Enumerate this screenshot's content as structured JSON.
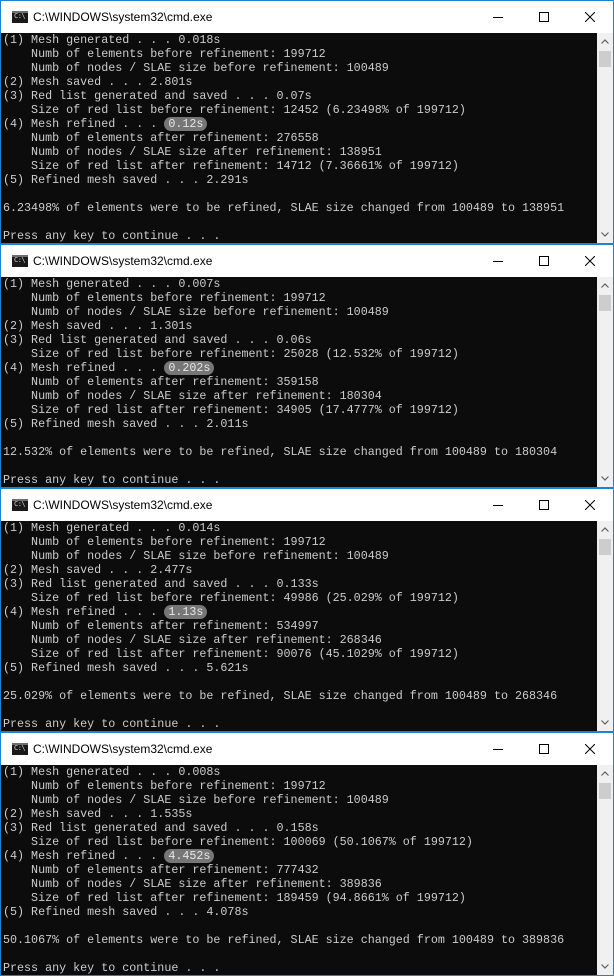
{
  "windows": [
    {
      "title": "C:\\WINDOWS\\system32\\cmd.exe",
      "lines": [
        {
          "text": "(1) Mesh generated . . . 0.018s"
        },
        {
          "text": "    Numb of elements before refinement: 199712"
        },
        {
          "text": "    Numb of nodes / SLAE size before refinement: 100489"
        },
        {
          "text": "(2) Mesh saved . . . 2.801s"
        },
        {
          "text": "(3) Red list generated and saved . . . 0.07s"
        },
        {
          "text": "    Size of red list before refinement: 12452 (6.23498% of 199712)"
        },
        {
          "text": "(4) Mesh refined . . . ",
          "highlight": "0.12s"
        },
        {
          "text": "    Numb of elements after refinement: 276558"
        },
        {
          "text": "    Numb of nodes / SLAE size after refinement: 138951"
        },
        {
          "text": "    Size of red list after refinement: 14712 (7.36661% of 199712)"
        },
        {
          "text": "(5) Refined mesh saved . . . 2.291s"
        },
        {
          "text": ""
        },
        {
          "text": "6.23498% of elements were to be refined, SLAE size changed from 100489 to 138951"
        },
        {
          "text": ""
        },
        {
          "text": "Press any key to continue . . ."
        }
      ]
    },
    {
      "title": "C:\\WINDOWS\\system32\\cmd.exe",
      "lines": [
        {
          "text": "(1) Mesh generated . . . 0.007s"
        },
        {
          "text": "    Numb of elements before refinement: 199712"
        },
        {
          "text": "    Numb of nodes / SLAE size before refinement: 100489"
        },
        {
          "text": "(2) Mesh saved . . . 1.301s"
        },
        {
          "text": "(3) Red list generated and saved . . . 0.06s"
        },
        {
          "text": "    Size of red list before refinement: 25028 (12.532% of 199712)"
        },
        {
          "text": "(4) Mesh refined . . . ",
          "highlight": "0.202s"
        },
        {
          "text": "    Numb of elements after refinement: 359158"
        },
        {
          "text": "    Numb of nodes / SLAE size after refinement: 180304"
        },
        {
          "text": "    Size of red list after refinement: 34905 (17.4777% of 199712)"
        },
        {
          "text": "(5) Refined mesh saved . . . 2.011s"
        },
        {
          "text": ""
        },
        {
          "text": "12.532% of elements were to be refined, SLAE size changed from 100489 to 180304"
        },
        {
          "text": ""
        },
        {
          "text": "Press any key to continue . . ."
        }
      ]
    },
    {
      "title": "C:\\WINDOWS\\system32\\cmd.exe",
      "lines": [
        {
          "text": "(1) Mesh generated . . . 0.014s"
        },
        {
          "text": "    Numb of elements before refinement: 199712"
        },
        {
          "text": "    Numb of nodes / SLAE size before refinement: 100489"
        },
        {
          "text": "(2) Mesh saved . . . 2.477s"
        },
        {
          "text": "(3) Red list generated and saved . . . 0.133s"
        },
        {
          "text": "    Size of red list before refinement: 49986 (25.029% of 199712)"
        },
        {
          "text": "(4) Mesh refined . . . ",
          "highlight": "1.13s"
        },
        {
          "text": "    Numb of elements after refinement: 534997"
        },
        {
          "text": "    Numb of nodes / SLAE size after refinement: 268346"
        },
        {
          "text": "    Size of red list after refinement: 90076 (45.1029% of 199712)"
        },
        {
          "text": "(5) Refined mesh saved . . . 5.621s"
        },
        {
          "text": ""
        },
        {
          "text": "25.029% of elements were to be refined, SLAE size changed from 100489 to 268346"
        },
        {
          "text": ""
        },
        {
          "text": "Press any key to continue . . ."
        }
      ]
    },
    {
      "title": "C:\\WINDOWS\\system32\\cmd.exe",
      "lines": [
        {
          "text": "(1) Mesh generated . . . 0.008s"
        },
        {
          "text": "    Numb of elements before refinement: 199712"
        },
        {
          "text": "    Numb of nodes / SLAE size before refinement: 100489"
        },
        {
          "text": "(2) Mesh saved . . . 1.535s"
        },
        {
          "text": "(3) Red list generated and saved . . . 0.158s"
        },
        {
          "text": "    Size of red list before refinement: 100069 (50.1067% of 199712)"
        },
        {
          "text": "(4) Mesh refined . . . ",
          "highlight": "4.452s"
        },
        {
          "text": "    Numb of elements after refinement: 777432"
        },
        {
          "text": "    Numb of nodes / SLAE size after refinement: 389836"
        },
        {
          "text": "    Size of red list after refinement: 189459 (94.8661% of 199712)"
        },
        {
          "text": "(5) Refined mesh saved . . . 4.078s"
        },
        {
          "text": ""
        },
        {
          "text": "50.1067% of elements were to be refined, SLAE size changed from 100489 to 389836"
        },
        {
          "text": ""
        },
        {
          "text": "Press any key to continue . . ."
        }
      ]
    }
  ],
  "icons": {
    "app": "cmd-icon",
    "minimize": "minimize-icon",
    "maximize": "maximize-icon",
    "close": "close-icon",
    "scroll_up": "scroll-up-arrow-icon",
    "scroll_down": "scroll-down-arrow-icon"
  },
  "colors": {
    "console_bg": "#0c0c0c",
    "console_text": "#cccccc",
    "highlight_bg": "#767676",
    "window_border": "#1883d7"
  }
}
